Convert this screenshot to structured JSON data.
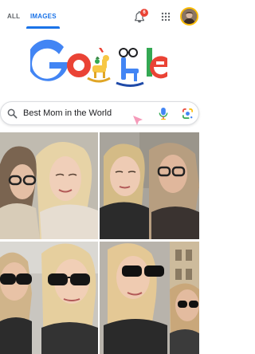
{
  "tabs": [
    {
      "label": "ALL",
      "active": false
    },
    {
      "label": "IMAGES",
      "active": true
    }
  ],
  "notifications": {
    "count": "6"
  },
  "search": {
    "query": "Best Mom in the World"
  },
  "icons": {
    "bell": "bell-icon",
    "apps": "apps-grid-icon",
    "search": "search-icon",
    "mic": "microphone-icon",
    "lens": "google-lens-icon"
  },
  "colors": {
    "accent": "#1a73e8",
    "badge": "#ea4335",
    "google_blue": "#4285f4",
    "google_red": "#ea4335",
    "google_yellow": "#fbbc04",
    "google_green": "#34a853"
  },
  "results": [
    {
      "id": "result-1"
    },
    {
      "id": "result-2"
    },
    {
      "id": "result-3"
    },
    {
      "id": "result-4"
    }
  ]
}
